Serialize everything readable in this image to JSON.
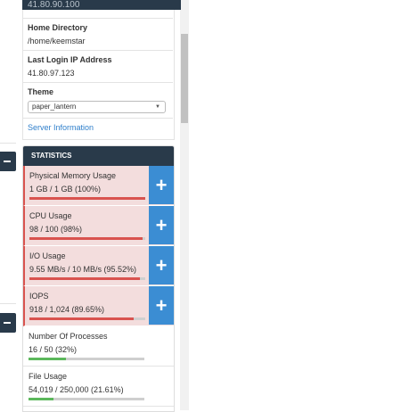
{
  "sidebar": {
    "partial_top_text": "41.80.90.100",
    "home_directory": {
      "label": "Home Directory",
      "value": "/home/keemstar"
    },
    "last_login_ip": {
      "label": "Last Login IP Address",
      "value": "41.80.97.123"
    },
    "theme": {
      "label": "Theme",
      "selected": "paper_lantern",
      "caret": "▼"
    },
    "server_information_link": "Server Information"
  },
  "statistics": {
    "title": "STATISTICS",
    "plus_symbol": "+",
    "items": [
      {
        "label": "Physical Memory Usage",
        "value": "1 GB / 1 GB   (100%)",
        "percent": 100,
        "status": "alert",
        "bar_color": "#d9534f"
      },
      {
        "label": "CPU Usage",
        "value": "98 / 100   (98%)",
        "percent": 98,
        "status": "alert",
        "bar_color": "#d9534f"
      },
      {
        "label": "I/O Usage",
        "value": "9.55 MB/s / 10 MB/s   (95.52%)",
        "percent": 95.52,
        "status": "alert",
        "bar_color": "#d9534f"
      },
      {
        "label": "IOPS",
        "value": "918 / 1,024   (89.65%)",
        "percent": 89.65,
        "status": "alert",
        "bar_color": "#d9534f"
      },
      {
        "label": "Number Of Processes",
        "value": "16 / 50   (32%)",
        "percent": 32,
        "status": "normal",
        "bar_color": "#5cb85c"
      },
      {
        "label": "File Usage",
        "value": "54,019 / 250,000   (21.61%)",
        "percent": 21.61,
        "status": "normal",
        "bar_color": "#5cb85c"
      }
    ]
  }
}
